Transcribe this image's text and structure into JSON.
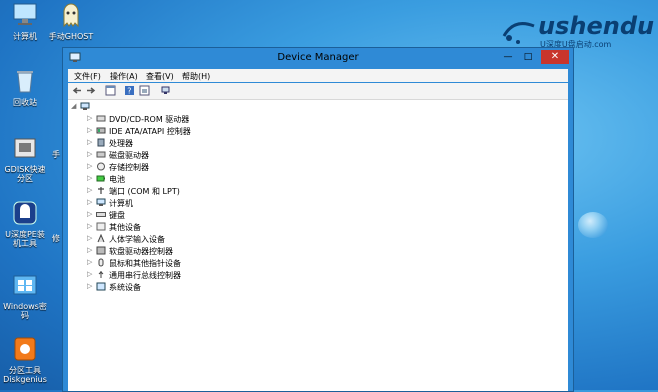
{
  "desktop": {
    "icons": [
      {
        "label": "计算机"
      },
      {
        "label": "手动GHOST"
      },
      {
        "label": "回收站"
      },
      {
        "label": "GDISK快速分区"
      },
      {
        "label": "U深度PE装机工具"
      },
      {
        "label": "Windows密码"
      },
      {
        "label": "分区工具Diskgenius"
      }
    ],
    "side_fragments": [
      "手",
      "修"
    ],
    "logo": {
      "text": "ushendu",
      "sub": "U深度U盘启动.com"
    }
  },
  "window": {
    "title": "Device Manager",
    "controls": {
      "minimize": "—",
      "maximize": "□",
      "close": "✕"
    },
    "menu": [
      "文件(F)",
      "操作(A)",
      "查看(V)",
      "帮助(H)"
    ],
    "toolbar": [
      "back-icon",
      "forward-icon",
      "properties-icon",
      "help-icon",
      "view-icon",
      "scan-icon"
    ],
    "tree": [
      {
        "label": "DVD/CD-ROM 驱动器",
        "icon": "dvd-drive-icon"
      },
      {
        "label": "IDE ATA/ATAPI 控制器",
        "icon": "ide-controller-icon"
      },
      {
        "label": "处理器",
        "icon": "processor-icon"
      },
      {
        "label": "磁盘驱动器",
        "icon": "disk-drive-icon"
      },
      {
        "label": "存储控制器",
        "icon": "storage-controller-icon"
      },
      {
        "label": "电池",
        "icon": "battery-icon"
      },
      {
        "label": "端口 (COM 和 LPT)",
        "icon": "port-icon"
      },
      {
        "label": "计算机",
        "icon": "computer-icon"
      },
      {
        "label": "键盘",
        "icon": "keyboard-icon"
      },
      {
        "label": "其他设备",
        "icon": "other-devices-icon"
      },
      {
        "label": "人体学输入设备",
        "icon": "hid-icon"
      },
      {
        "label": "软盘驱动器控制器",
        "icon": "floppy-controller-icon"
      },
      {
        "label": "鼠标和其他指针设备",
        "icon": "mouse-icon"
      },
      {
        "label": "通用串行总线控制器",
        "icon": "usb-icon"
      },
      {
        "label": "系统设备",
        "icon": "system-devices-icon"
      }
    ]
  }
}
